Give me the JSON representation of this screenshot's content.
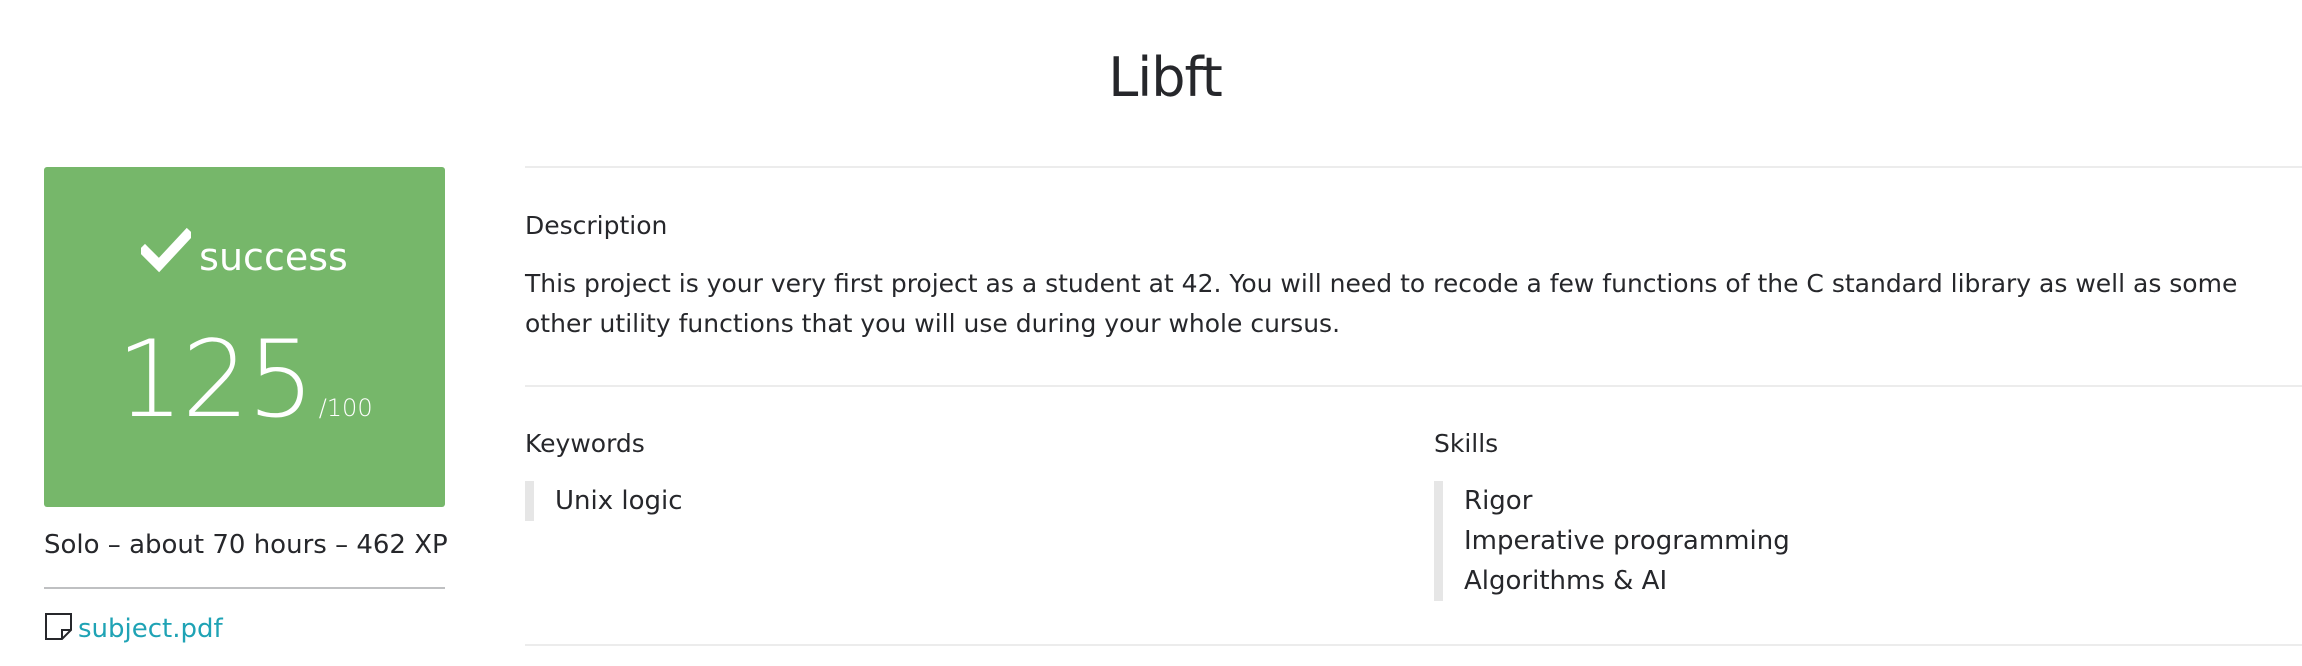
{
  "project": {
    "title": "Libft"
  },
  "score": {
    "status": "success",
    "grade": "125",
    "grade_max": "/100",
    "color": "#76b76a",
    "icon": "check-icon"
  },
  "meta": {
    "summary": "Solo – about 70 hours – 462 XP"
  },
  "attachment": {
    "icon": "document-icon",
    "label": "subject.pdf",
    "color": "#1fa3b5"
  },
  "description": {
    "label": "Description",
    "text": "This project is your very first project as a student at 42. You will need to recode a few functions of the C standard library as well as some other utility functions that you will use during your whole cursus."
  },
  "keywords": {
    "label": "Keywords",
    "items": [
      "Unix logic"
    ]
  },
  "skills": {
    "label": "Skills",
    "items": [
      "Rigor",
      "Imperative programming",
      "Algorithms & AI"
    ]
  }
}
